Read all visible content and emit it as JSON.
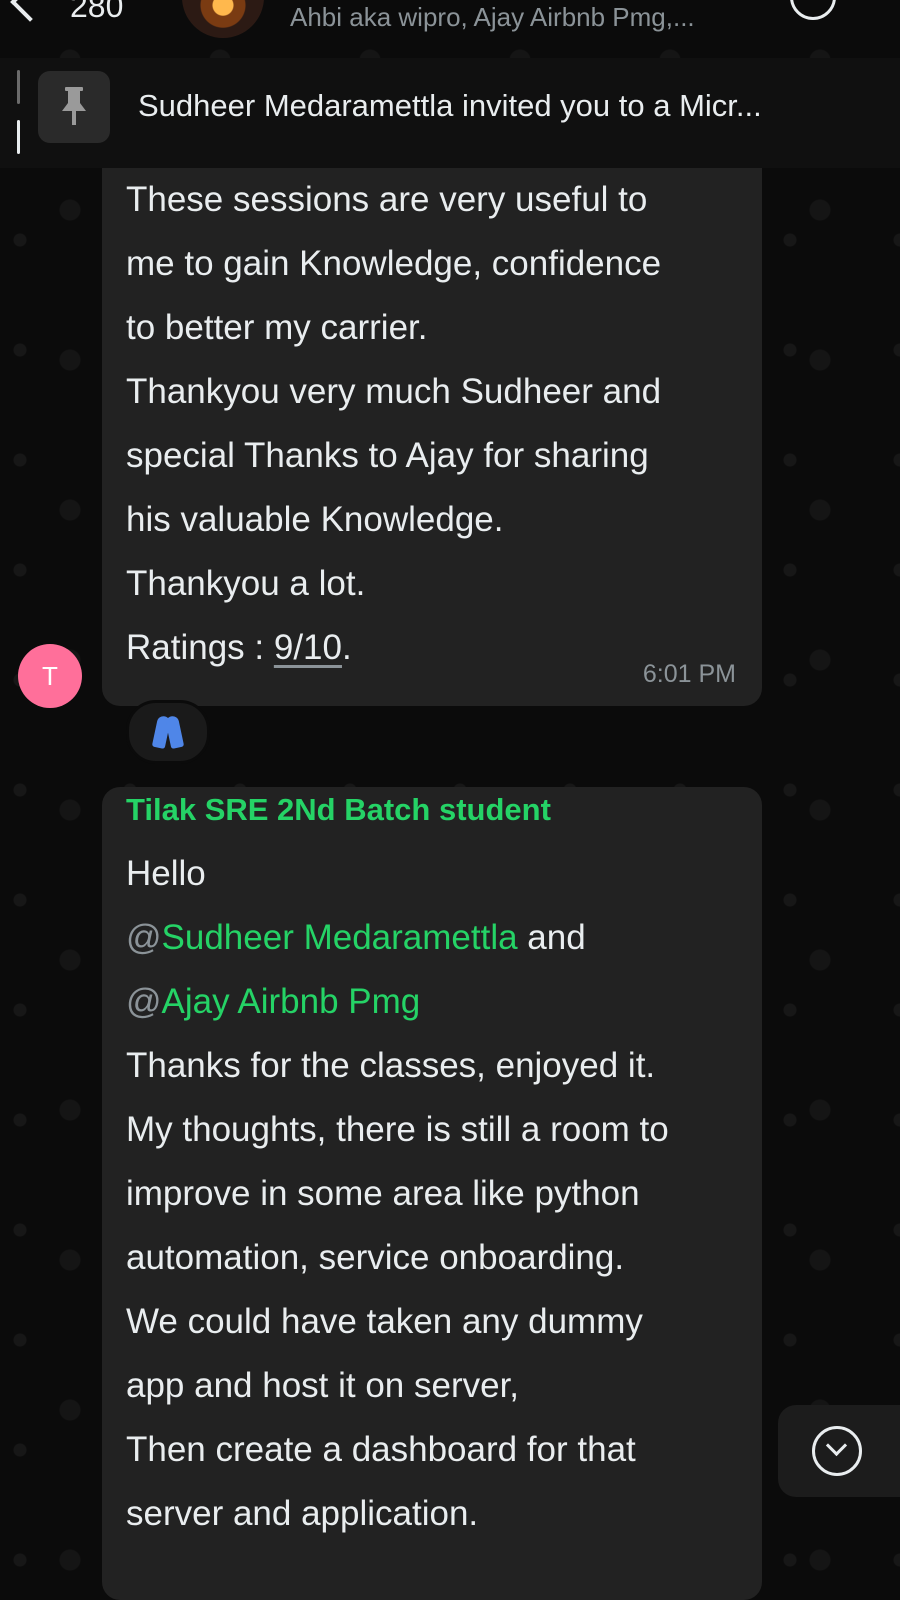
{
  "header": {
    "back_count": "280",
    "participants": "Ahbi aka wipro, Ajay Airbnb Pmg,..."
  },
  "pinned": {
    "text": "Sudheer Medaramettla invited you to a Micr..."
  },
  "messages": [
    {
      "avatar_initial": "T",
      "lines": [
        "These sessions are very useful to",
        "me to gain Knowledge, confidence",
        "to better my carrier.",
        "Thankyou very much Sudheer and",
        "special Thanks to Ajay for sharing",
        "his valuable Knowledge.",
        "Thankyou a lot."
      ],
      "rating_label": "Ratings : ",
      "rating_value": "9/10",
      "rating_suffix": ".",
      "time": "6:01 PM",
      "reaction": "🙏"
    },
    {
      "sender": "Tilak SRE 2Nd Batch student",
      "greeting": "Hello",
      "mention1": "Sudheer Medaramettla",
      "mention1_suffix": " and",
      "mention2": "Ajay Airbnb Pmg",
      "at": "@",
      "lines": [
        "Thanks for the classes, enjoyed it.",
        "My thoughts, there is still a room to",
        "improve in some area like python",
        "automation, service onboarding.",
        "We could have taken any dummy",
        "app and host it on server,",
        "Then create a dashboard for that",
        "server and application."
      ]
    }
  ],
  "icons": {
    "back": "chevron-left-icon",
    "pin": "pin-icon",
    "reaction": "folded-hands-icon",
    "scroll": "chevron-down-icon",
    "call": "video-call-icon"
  },
  "colors": {
    "accent": "#25d366",
    "bubble": "#222222",
    "background": "#0b0b0b",
    "avatar": "#ff6f9a"
  }
}
